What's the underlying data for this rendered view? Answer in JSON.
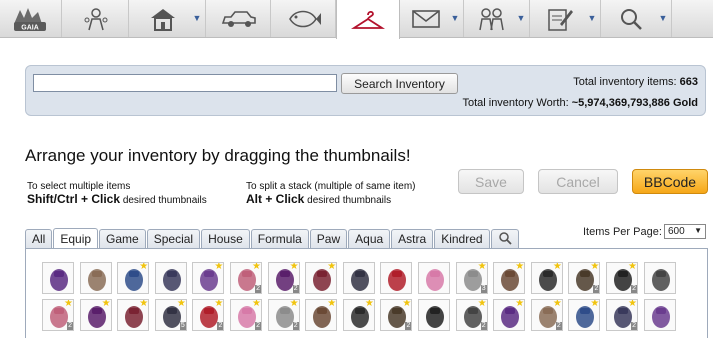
{
  "nav": {
    "items": [
      {
        "name": "gaia-logo-icon",
        "has_menu": false
      },
      {
        "name": "avatar-icon",
        "has_menu": false
      },
      {
        "name": "house-icon",
        "has_menu": true
      },
      {
        "name": "car-icon",
        "has_menu": false
      },
      {
        "name": "fish-icon",
        "has_menu": false
      },
      {
        "name": "hanger-icon",
        "has_menu": false,
        "active": true
      },
      {
        "name": "envelope-icon",
        "has_menu": true
      },
      {
        "name": "friends-icon",
        "has_menu": true
      },
      {
        "name": "notepad-icon",
        "has_menu": true
      },
      {
        "name": "search-icon",
        "has_menu": true
      }
    ],
    "logo_text": "GAIA",
    "arrow_glyph": "▼"
  },
  "search": {
    "value": "",
    "placeholder": "",
    "button_label": "Search Inventory"
  },
  "totals": {
    "items_label": "Total inventory items:",
    "items_value": "663",
    "worth_label": "Total inventory Worth:",
    "worth_value": "~5,974,369,793,886 Gold"
  },
  "arrange_title": "Arrange your inventory by dragging the thumbnails!",
  "tips": {
    "multi_select_line1": "To select multiple items",
    "multi_select_keys": "Shift/Ctrl + Click",
    "multi_select_suffix": "desired thumbnails",
    "split_stack_line1": "To split a stack",
    "split_stack_note": "(multiple of same item)",
    "split_stack_keys": "Alt + Click",
    "split_stack_suffix": "desired thumbnails"
  },
  "actions": {
    "save_label": "Save",
    "cancel_label": "Cancel",
    "bbcode_label": "BBCode"
  },
  "tabs": [
    "All",
    "Equip",
    "Game",
    "Special",
    "House",
    "Formula",
    "Paw",
    "Aqua",
    "Astra",
    "Kindred"
  ],
  "active_tab": "Equip",
  "per_page": {
    "label": "Items Per Page:",
    "value": "600",
    "caret": "▼"
  },
  "colors": {
    "accent_orange": "#f6a718",
    "panel_blue": "#dce3ec",
    "nav_active_icon": "#b3122d"
  },
  "items_row1": [
    {
      "icon": "purple-crystal-item",
      "star": false,
      "qty": ""
    },
    {
      "icon": "antlers-item",
      "star": false,
      "qty": ""
    },
    {
      "icon": "blue-pants-item",
      "star": true,
      "qty": ""
    },
    {
      "icon": "dark-claws-item",
      "star": false,
      "qty": ""
    },
    {
      "icon": "purple-wings-item",
      "star": true,
      "qty": ""
    },
    {
      "icon": "pink-sprite-item",
      "star": true,
      "qty": "2"
    },
    {
      "icon": "purple-hair-item",
      "star": true,
      "qty": "2"
    },
    {
      "icon": "red-cap-item",
      "star": true,
      "qty": ""
    },
    {
      "icon": "dark-bush-item",
      "star": false,
      "qty": ""
    },
    {
      "icon": "red-bauble-item",
      "star": false,
      "qty": ""
    },
    {
      "icon": "pink-portrait-item",
      "star": false,
      "qty": ""
    },
    {
      "icon": "creature-item",
      "star": true,
      "qty": "3"
    },
    {
      "icon": "brown-bug-item",
      "star": true,
      "qty": ""
    },
    {
      "icon": "black-feather-item",
      "star": true,
      "qty": ""
    },
    {
      "icon": "beetle-item",
      "star": true,
      "qty": "2"
    },
    {
      "icon": "black-bird-item",
      "star": true,
      "qty": "2"
    },
    {
      "icon": "coat-hanger-item",
      "star": false,
      "qty": ""
    }
  ],
  "items_row2": [
    {
      "icon": "feather-quill-item",
      "star": true,
      "qty": "2"
    },
    {
      "icon": "dark-mask-item",
      "star": true,
      "qty": ""
    },
    {
      "icon": "red-hat-item",
      "star": true,
      "qty": ""
    },
    {
      "icon": "red-shirt-item",
      "star": true,
      "qty": "5"
    },
    {
      "icon": "white-dress-item",
      "star": true,
      "qty": "2"
    },
    {
      "icon": "pixel-dog-item",
      "star": true,
      "qty": "2"
    },
    {
      "icon": "black-boots-item",
      "star": true,
      "qty": "2"
    },
    {
      "icon": "striped-shirt-item",
      "star": true,
      "qty": ""
    },
    {
      "icon": "dark-sprite-item",
      "star": true,
      "qty": ""
    },
    {
      "icon": "silver-gear-item",
      "star": true,
      "qty": "2"
    },
    {
      "icon": "red-orb-item",
      "star": false,
      "qty": ""
    },
    {
      "icon": "skull-mask-item",
      "star": true,
      "qty": "2"
    },
    {
      "icon": "black-horns-item",
      "star": true,
      "qty": ""
    },
    {
      "icon": "black-cat-item",
      "star": true,
      "qty": "2"
    },
    {
      "icon": "grey-figure-item",
      "star": true,
      "qty": ""
    },
    {
      "icon": "stone-wings-item",
      "star": true,
      "qty": "2"
    },
    {
      "icon": "black-hanger-item",
      "star": false,
      "qty": ""
    }
  ]
}
